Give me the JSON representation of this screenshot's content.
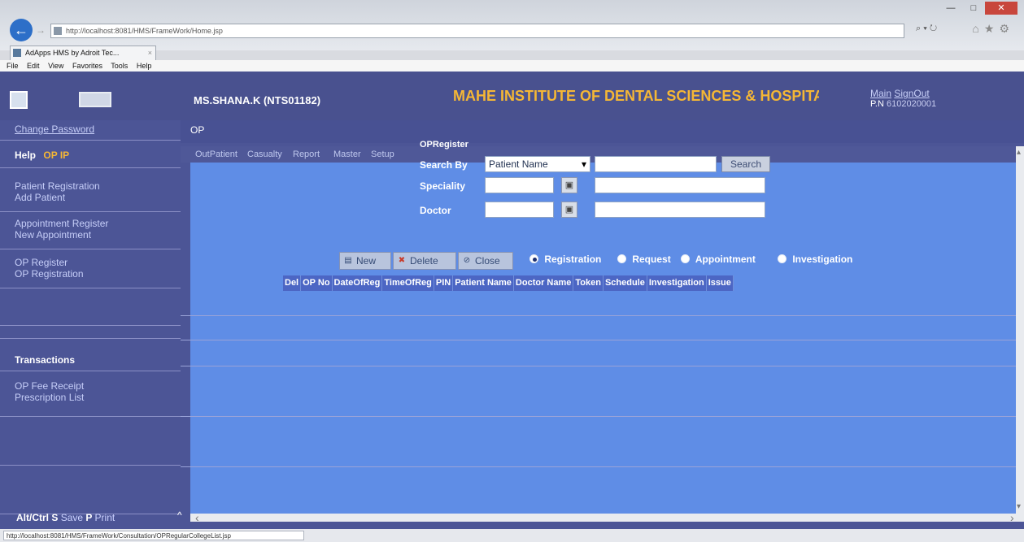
{
  "browser": {
    "address_url": "http://localhost:8081/HMS/FrameWork/Home.jsp",
    "tab_title": "AdApps HMS by Adroit Tec...",
    "menu": [
      "File",
      "Edit",
      "View",
      "Favorites",
      "Tools",
      "Help"
    ],
    "status_url": "http://localhost:8081/HMS/FrameWork/Consultation/OPRegularCollegeList.jsp"
  },
  "header": {
    "user": "MS.SHANA.K (NTS01182)",
    "institute": "MAHE INSTITUTE OF DENTAL SCIENCES & HOSPITAL",
    "main_link": "Main",
    "signout_link": "SignOut",
    "pn_label": "P.N",
    "pn_value": "6102020001"
  },
  "sidebar": {
    "change_password": "Change Password",
    "help": "Help",
    "op_ip": "OP IP",
    "patient_registration": "Patient Registration",
    "add_patient": "Add Patient",
    "appointment_register": "Appointment Register",
    "new_appointment": "New Appointment",
    "op_register": "OP Register",
    "op_registration": "OP Registration",
    "transactions": "Transactions",
    "op_fee_receipt": "OP Fee Receipt",
    "prescription_list": "Prescription List"
  },
  "op": {
    "label": "OP",
    "menus": [
      "OutPatient",
      "Casualty",
      "Report",
      "Master",
      "Setup"
    ]
  },
  "form": {
    "title": "OPRegister",
    "search_by_label": "Search By",
    "search_by_value": "Patient Name",
    "search_button": "Search",
    "speciality_label": "Speciality",
    "doctor_label": "Doctor",
    "new_button": "New",
    "delete_button": "Delete",
    "close_button": "Close",
    "radios": {
      "registration": "Registration",
      "request": "Request",
      "appointment": "Appointment",
      "investigation": "Investigation"
    }
  },
  "table": {
    "headers": [
      "Del",
      "OP No",
      "DateOfReg",
      "TimeOfReg",
      "PIN",
      "Patient Name",
      "Doctor Name",
      "Token",
      "Schedule",
      "Investigation",
      "Issue"
    ]
  },
  "footer": {
    "alt_ctrl": "Alt/Ctrl",
    "s_key": "S",
    "save": "Save",
    "p_key": "P",
    "print": "Print"
  }
}
